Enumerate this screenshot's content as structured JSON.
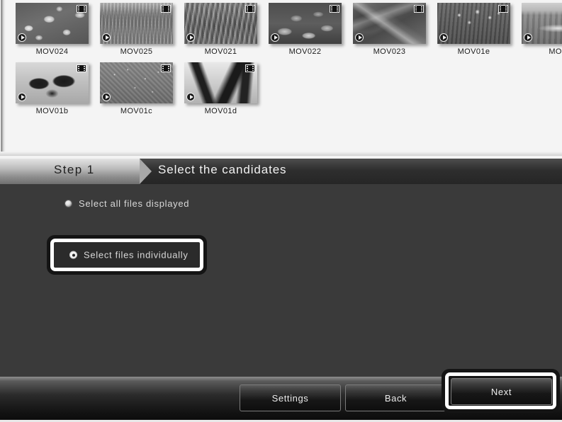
{
  "window": {
    "title": "Select the candidates"
  },
  "browser": {
    "thumbnails_row1": [
      {
        "label": "MOV024",
        "photo": "ph-flowers",
        "film_icon": "film-strip-icon",
        "play_icon": "play-icon"
      },
      {
        "label": "MOV025",
        "photo": "ph-track",
        "film_icon": "film-strip-icon",
        "play_icon": "play-icon"
      },
      {
        "label": "MOV021",
        "photo": "ph-rows",
        "film_icon": "film-strip-icon",
        "play_icon": "play-icon"
      },
      {
        "label": "MOV022",
        "photo": "ph-lily",
        "film_icon": "film-strip-icon",
        "play_icon": "play-icon"
      },
      {
        "label": "MOV023",
        "photo": "ph-leaf",
        "film_icon": "film-strip-icon",
        "play_icon": "play-icon"
      },
      {
        "label": "MOV01e",
        "photo": "ph-meadow",
        "film_icon": "film-strip-icon",
        "play_icon": "play-icon"
      },
      {
        "label": "MOV",
        "photo": "ph-road",
        "film_icon": "film-strip-icon",
        "play_icon": "play-icon"
      }
    ],
    "thumbnails_row2": [
      {
        "label": "MOV01b",
        "photo": "ph-darkflower",
        "film_icon": "film-strip-icon",
        "play_icon": "play-icon"
      },
      {
        "label": "MOV01c",
        "photo": "ph-gravel",
        "film_icon": "film-strip-icon",
        "play_icon": "play-icon"
      },
      {
        "label": "MOV01d",
        "photo": "ph-branch",
        "film_icon": "film-strip-icon",
        "play_icon": "play-icon"
      }
    ]
  },
  "step": {
    "badge": "Step 1",
    "title": "Select the candidates"
  },
  "options": {
    "select_all": {
      "label": "Select all files displayed",
      "selected": false
    },
    "select_individually": {
      "label": "Select files individually",
      "selected": true,
      "focused": true
    }
  },
  "footer": {
    "settings_label": "Settings",
    "back_label": "Back",
    "next_label": "Next",
    "next_focused": true
  },
  "colors": {
    "panel_bg": "#3a3a3a",
    "browser_bg": "#f4f4f4",
    "focus_ring": "#ffffff",
    "text_light": "#d8d8d8",
    "text_dark": "#1c1c1c"
  }
}
